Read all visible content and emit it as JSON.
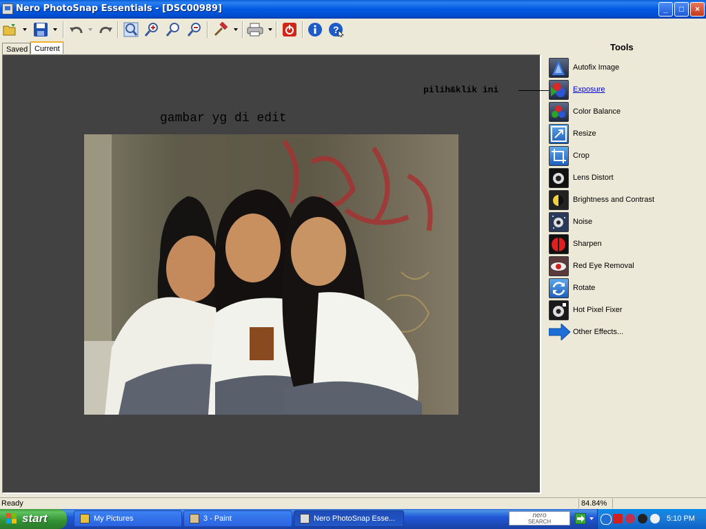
{
  "window": {
    "title": "Nero PhotoSnap Essentials - [DSC00989]"
  },
  "tabs": [
    {
      "label": "Saved"
    },
    {
      "label": "Current"
    }
  ],
  "canvas": {
    "caption": "gambar yg di edit"
  },
  "tools": {
    "title": "Tools",
    "items": [
      {
        "label": "Autofix Image",
        "icon": "autofix-icon"
      },
      {
        "label": "Exposure",
        "icon": "exposure-icon"
      },
      {
        "label": "Color Balance",
        "icon": "color-balance-icon"
      },
      {
        "label": "Resize",
        "icon": "resize-icon"
      },
      {
        "label": "Crop",
        "icon": "crop-icon"
      },
      {
        "label": "Lens Distort",
        "icon": "lens-distort-icon"
      },
      {
        "label": "Brightness and Contrast",
        "icon": "brightness-contrast-icon"
      },
      {
        "label": "Noise",
        "icon": "noise-icon"
      },
      {
        "label": "Sharpen",
        "icon": "sharpen-icon"
      },
      {
        "label": "Red Eye Removal",
        "icon": "red-eye-icon"
      },
      {
        "label": "Rotate",
        "icon": "rotate-icon"
      },
      {
        "label": "Hot Pixel Fixer",
        "icon": "hot-pixel-icon"
      },
      {
        "label": "Other Effects...",
        "icon": "arrow-right-icon"
      }
    ]
  },
  "annotation": {
    "text": "pilih&klik ini"
  },
  "status": {
    "text": "Ready",
    "zoom": "84.84%"
  },
  "taskbar": {
    "start": "start",
    "tasks": [
      {
        "label": "My Pictures"
      },
      {
        "label": "3 - Paint"
      },
      {
        "label": "Nero PhotoSnap Esse..."
      }
    ],
    "nero_search": {
      "line1": "nero",
      "line2": "SEARCH"
    },
    "clock": "5:10 PM"
  },
  "colors": {
    "accent": "#0058e0",
    "panel_bg": "#424242",
    "link": "#0000cc"
  }
}
